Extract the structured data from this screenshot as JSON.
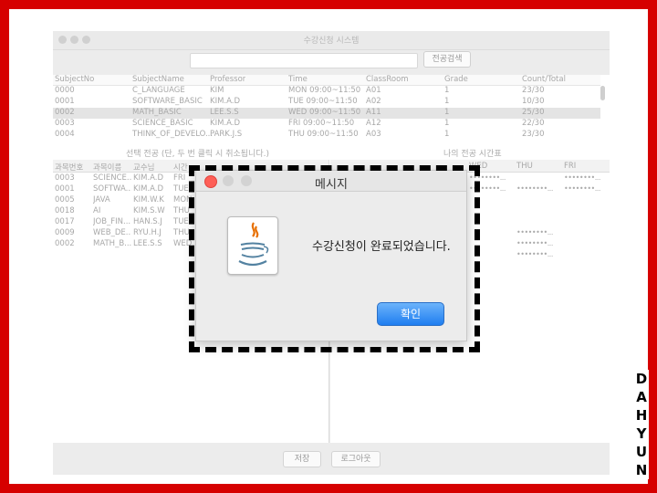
{
  "window": {
    "title": "수강신청 시스템"
  },
  "search": {
    "value": "",
    "button_label": "전공검색"
  },
  "subjects": {
    "columns": [
      "SubjectNo",
      "SubjectName",
      "Professor",
      "Time",
      "ClassRoom",
      "Grade",
      "Count/Total"
    ],
    "rows": [
      [
        "0000",
        "C_LANGUAGE",
        "KIM",
        "MON 09:00~11:50",
        "A01",
        "1",
        "23/30"
      ],
      [
        "0001",
        "SOFTWARE_BASIC",
        "KIM.A.D",
        "TUE 09:00~11:50",
        "A02",
        "1",
        "10/30"
      ],
      [
        "0002",
        "MATH_BASIC",
        "LEE.S.S",
        "WED 09:00~11:50",
        "A11",
        "1",
        "25/30"
      ],
      [
        "0003",
        "SCIENCE_BASIC",
        "KIM.A.D",
        "FRI 09:00~11:50",
        "A12",
        "1",
        "22/30"
      ],
      [
        "0004",
        "THINK_OF_DEVELO...",
        "PARK.J.S",
        "THU 09:00~11:50",
        "A03",
        "1",
        "23/30"
      ]
    ],
    "selected_row": 2
  },
  "selected_panel": {
    "label": "선택 전공 (단, 두 번 클릭 시 취소됩니다.)",
    "columns": [
      "과목번호",
      "과목이름",
      "교수님",
      "시간"
    ],
    "rows": [
      [
        "0003",
        "SCIENCE...",
        "KIM.A.D",
        "FRI"
      ],
      [
        "0001",
        "SOFTWA...",
        "KIM.A.D",
        "TUE"
      ],
      [
        "0005",
        "JAVA",
        "KIM.W.K",
        "MON"
      ],
      [
        "0018",
        "AI",
        "KIM.S.W",
        "THU"
      ],
      [
        "0017",
        "JOB_FIN...",
        "HAN.S.J",
        "TUE"
      ],
      [
        "0009",
        "WEB_DE...",
        "RYU.H.J",
        "THU"
      ],
      [
        "0002",
        "MATH_B...",
        "LEE.S.S",
        "WED"
      ]
    ]
  },
  "timetable": {
    "label": "나의 전공 시간표",
    "columns": [
      "WED",
      "THU",
      "FRI"
    ],
    "slots": [
      [
        "••••••••...",
        "",
        "••••••••..."
      ],
      [
        "••••••••...",
        "••••••••...",
        "••••••••..."
      ],
      [
        "",
        "••••••••...",
        ""
      ],
      [
        "",
        "••••••••...",
        ""
      ],
      [
        "",
        "••••••••...",
        ""
      ]
    ]
  },
  "footer": {
    "save_label": "저장",
    "logout_label": "로그아웃"
  },
  "dialog": {
    "title": "메시지",
    "message": "수강신청이 완료되었습니다.",
    "ok_label": "확인",
    "icon": "java-icon"
  },
  "brand": {
    "letters": [
      "D",
      "A",
      "H",
      "Y",
      "U",
      "N"
    ]
  },
  "colors": {
    "frame": "#d60000",
    "ok_button": "#1f7ef0",
    "dash": "#000000"
  }
}
